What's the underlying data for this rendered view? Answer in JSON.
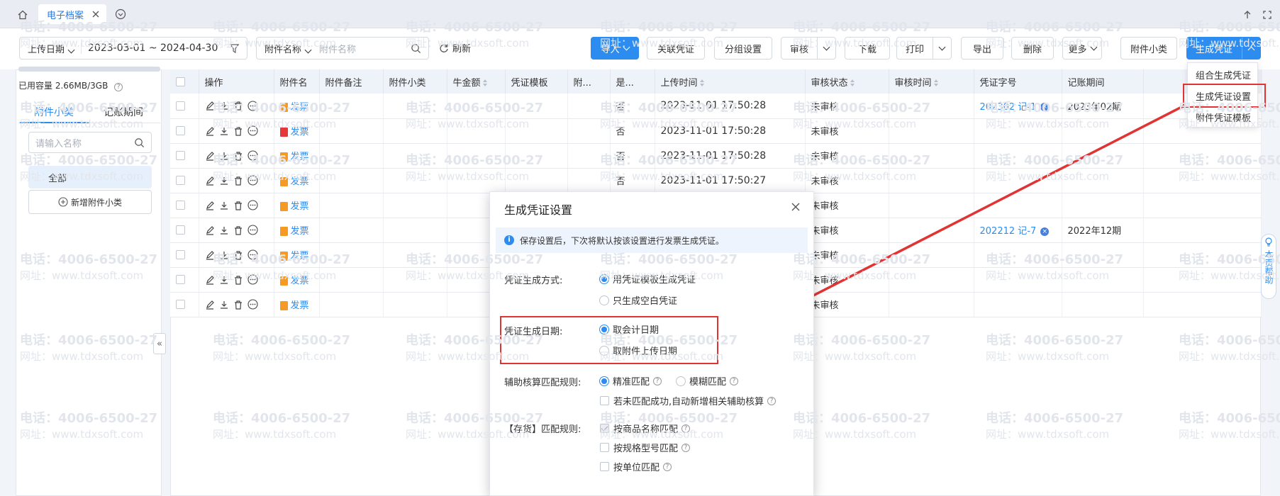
{
  "tabs": {
    "active_label": "电子档案"
  },
  "toolbar": {
    "date_type": "上传日期",
    "date_range": "2023-03-01 ~ 2024-04-30",
    "field_type": "附件名称",
    "field_placeholder": "附件名称",
    "refresh": "刷新",
    "buttons": {
      "import": "导入",
      "link": "关联凭证",
      "group": "分组设置",
      "audit": "审核",
      "download": "下载",
      "print": "打印",
      "export": "导出",
      "delete": "删除",
      "more": "更多",
      "subcat": "附件小类",
      "generate": "生成凭证"
    }
  },
  "left": {
    "capacity": "已用容量 2.66MB/3GB",
    "tab1": "附件小类",
    "tab2": "记账期间",
    "search_placeholder": "请输入名称",
    "all": "全部",
    "add": "新增附件小类"
  },
  "table": {
    "headers": [
      "操作",
      "附件名",
      "附件备注",
      "附件小类",
      "牛金额",
      "凭证模板",
      "附...",
      "是...",
      "上传时间",
      "审核状态",
      "审核时间",
      "凭证字号",
      "记账期间"
    ],
    "rows": [
      {
        "file": "发票",
        "pdf": false,
        "is": "否",
        "time": "2023-11-01 17:50:28",
        "status": "未审核",
        "voucher": "202302 记-1",
        "period": "2023年02期"
      },
      {
        "file": "发票",
        "pdf": true,
        "is": "否",
        "time": "2023-11-01 17:50:28",
        "status": "未审核",
        "voucher": "",
        "period": ""
      },
      {
        "file": "发票",
        "pdf": false,
        "is": "否",
        "time": "2023-11-01 17:50:28",
        "status": "未审核",
        "voucher": "",
        "period": ""
      },
      {
        "file": "发票",
        "pdf": false,
        "is": "否",
        "time": "2023-11-01 17:50:27",
        "status": "未审核",
        "voucher": "",
        "period": ""
      },
      {
        "file": "发票",
        "pdf": false,
        "is": "",
        "time": "",
        "status": "未审核",
        "voucher": "",
        "period": ""
      },
      {
        "file": "发票",
        "pdf": false,
        "is": "",
        "time": "",
        "status": "未审核",
        "voucher": "202212 记-7",
        "period": "2022年12期"
      },
      {
        "file": "发票",
        "pdf": false,
        "is": "",
        "time": "",
        "status": "未审核",
        "voucher": "",
        "period": ""
      },
      {
        "file": "发票",
        "pdf": false,
        "is": "",
        "time": "",
        "status": "未审核",
        "voucher": "",
        "period": ""
      },
      {
        "file": "发票",
        "pdf": false,
        "is": "",
        "time": "",
        "status": "未审核",
        "voucher": "",
        "period": ""
      }
    ]
  },
  "dropdown": {
    "items": [
      "组合生成凭证",
      "生成凭证设置",
      "附件凭证模板"
    ]
  },
  "dialog": {
    "title": "生成凭证设置",
    "info": "保存设置后，下次将默认按该设置进行发票生成凭证。",
    "method_label": "凭证生成方式:",
    "method_opt1": "用凭证模板生成凭证",
    "method_opt2": "只生成空白凭证",
    "date_label": "凭证生成日期:",
    "date_opt1": "取会计日期",
    "date_opt2": "取附件上传日期",
    "aux_label": "辅助核算匹配规则:",
    "aux_opt1": "精准匹配",
    "aux_opt2": "模糊匹配",
    "aux_check": "若未匹配成功,自动新增相关辅助核算",
    "inv_label": "【存货】匹配规则:",
    "inv_opt1": "按商品名称匹配",
    "inv_opt2": "按规格型号匹配",
    "inv_opt3": "按单位匹配"
  },
  "help": {
    "text": "本页帮助"
  },
  "watermark": {
    "phone": "电话：4006-6500-27",
    "site": "网址：www.tdxsoft.com"
  },
  "colors": {
    "primary": "#2d8cf0",
    "highlight": "#e03434"
  }
}
